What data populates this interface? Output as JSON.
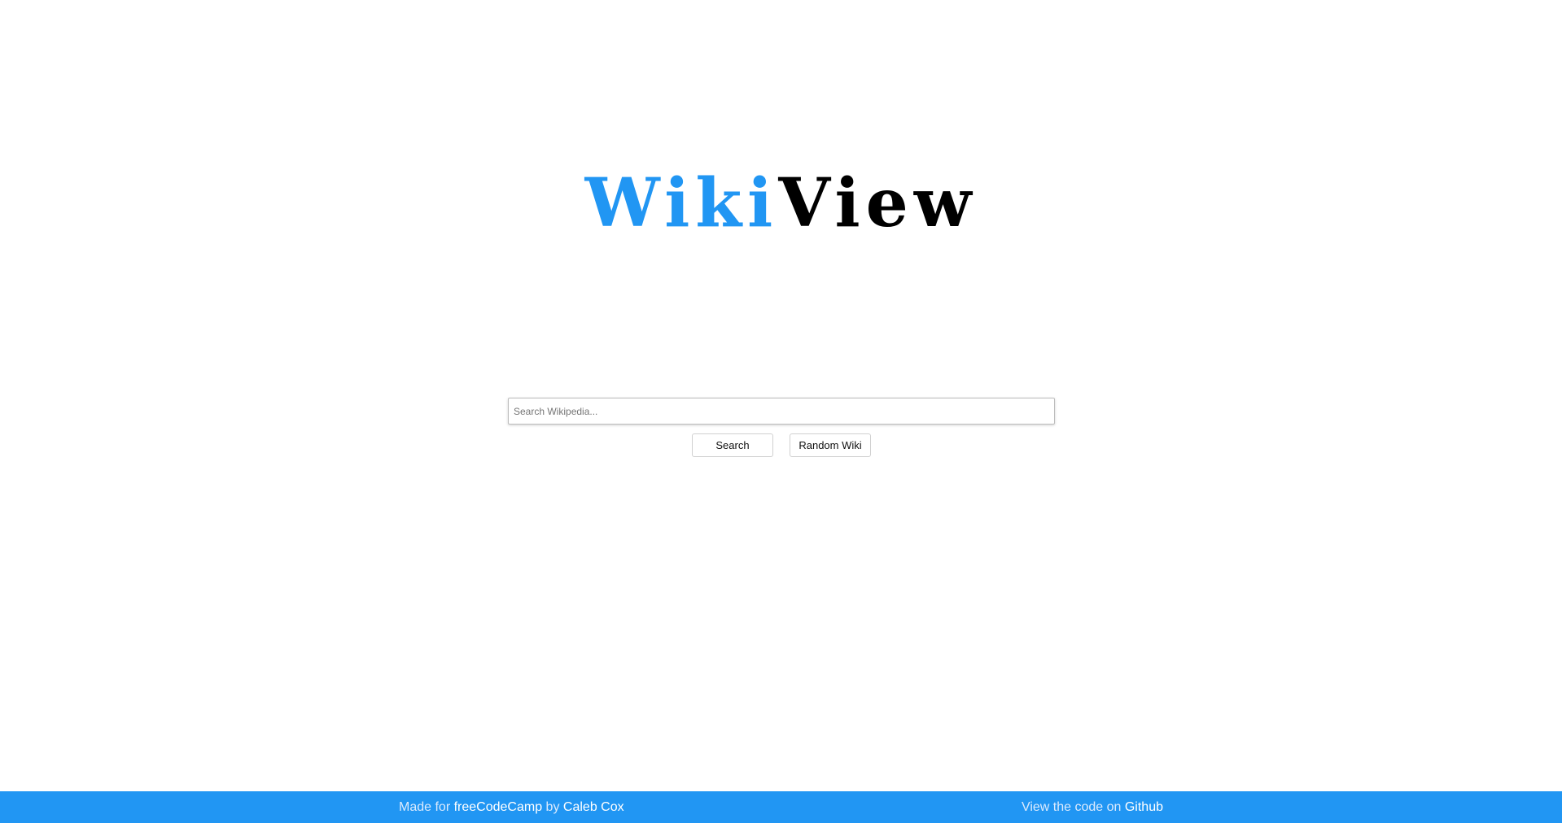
{
  "logo": {
    "part_a": "Wiki",
    "part_b": "View",
    "accent_color": "#2196f3"
  },
  "search": {
    "placeholder": "Search Wikipedia...",
    "value": ""
  },
  "buttons": {
    "search_label": "Search",
    "random_label": "Random Wiki"
  },
  "footer": {
    "made_for_prefix": "Made for",
    "freecodecamp_link": "freeCodeCamp",
    "by_text": "by",
    "author_link": "Caleb Cox",
    "view_code_prefix": "View the code on",
    "github_link": "Github",
    "background_color": "#2196f3"
  }
}
